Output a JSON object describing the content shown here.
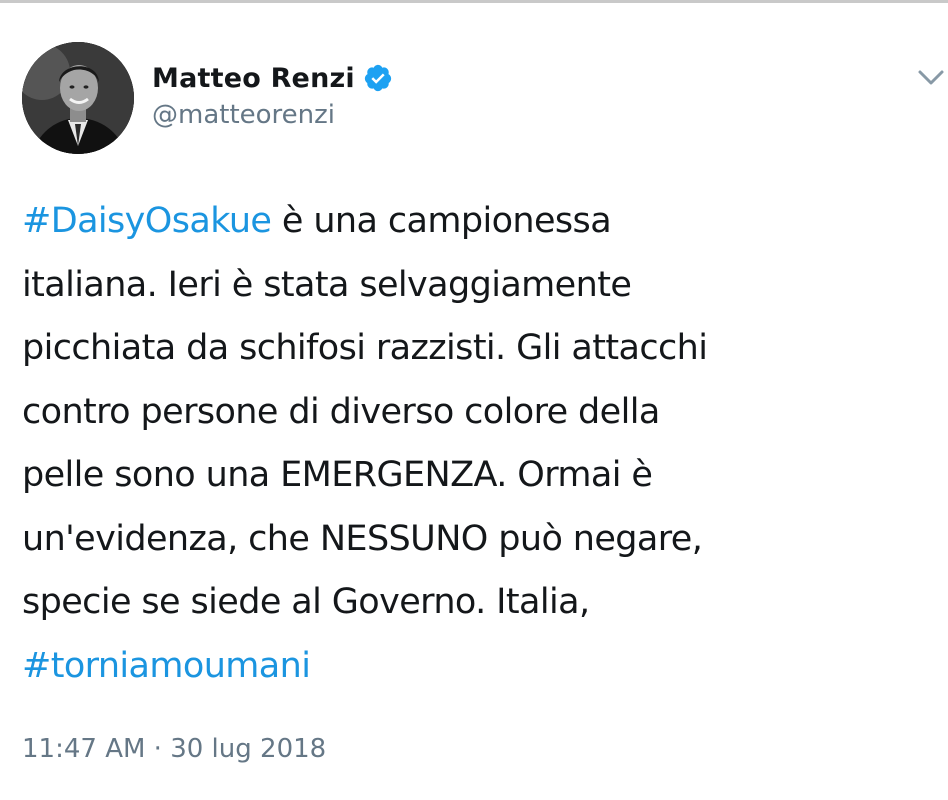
{
  "author": {
    "display_name": "Matteo Renzi",
    "handle": "@matteorenzi",
    "verified": true,
    "avatar_icon": "profile-photo"
  },
  "menu_icon": "chevron-down-icon",
  "tweet": {
    "lines": [
      {
        "hashtag": "#DaisyOsakue",
        "text": " è una campionessa"
      },
      {
        "text": "italiana. Ieri è stata selvaggiamente"
      },
      {
        "text": "picchiata da schifosi razzisti. Gli attacchi"
      },
      {
        "text": "contro persone di diverso colore della"
      },
      {
        "text": "pelle sono una EMERGENZA. Ormai è"
      },
      {
        "text": "un'evidenza, che NESSUNO può negare,"
      },
      {
        "text": "specie se siede al Governo. Italia,"
      },
      {
        "hashtag": "#torniamoumani"
      }
    ]
  },
  "timestamp": "11:47 AM · 30 lug 2018",
  "colors": {
    "link": "#1b95e0",
    "text": "#14171a",
    "muted": "#657786",
    "verified_badge": "#1da1f2"
  }
}
